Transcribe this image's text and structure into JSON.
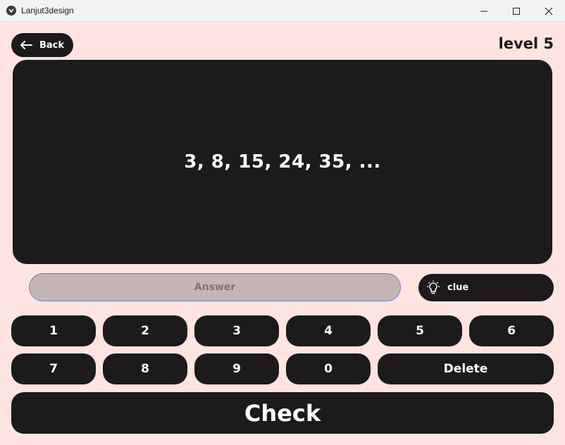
{
  "window": {
    "title": "Lanjut3design",
    "icons": {
      "app": "app-logo-icon",
      "minimize": "minimize-icon",
      "maximize": "maximize-icon",
      "close": "close-icon"
    }
  },
  "header": {
    "back_label": "Back",
    "back_icon": "arrow-left-icon",
    "level_label": "level 5"
  },
  "question": {
    "text": "3, 8, 15, 24, 35, ..."
  },
  "answer": {
    "placeholder": "Answer",
    "value": ""
  },
  "clue": {
    "label": "clue",
    "icon": "lightbulb-icon"
  },
  "keypad": {
    "row1": [
      "1",
      "2",
      "3",
      "4",
      "5",
      "6"
    ],
    "row2": [
      "7",
      "8",
      "9",
      "0"
    ],
    "delete_label": "Delete"
  },
  "check_label": "Check",
  "colors": {
    "background": "#ffe4e1",
    "dark": "#1c1a1a",
    "input_fill": "#c4b5b5",
    "input_border": "#5b86d6"
  }
}
